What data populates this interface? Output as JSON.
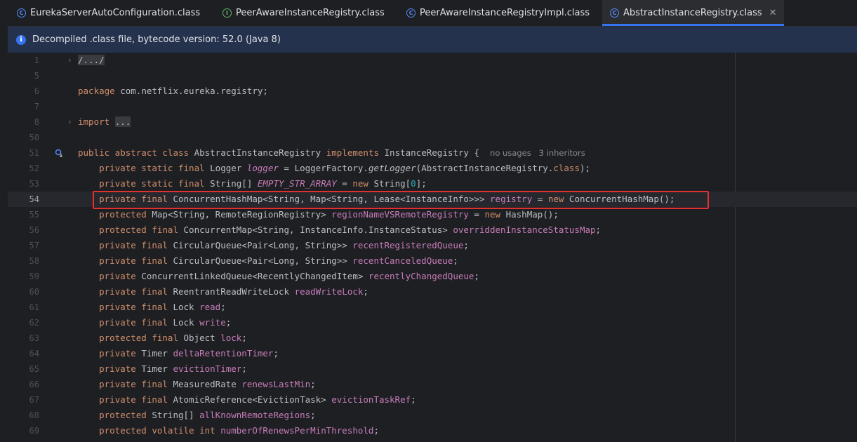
{
  "tabs": [
    {
      "label": "EurekaServerAutoConfiguration.class",
      "icon": "class-icon"
    },
    {
      "label": "PeerAwareInstanceRegistry.class",
      "icon": "interface-icon"
    },
    {
      "label": "PeerAwareInstanceRegistryImpl.class",
      "icon": "class-icon"
    },
    {
      "label": "AbstractInstanceRegistry.class",
      "icon": "class-icon"
    }
  ],
  "active_tab_close": "✕",
  "banner": {
    "text": "Decompiled .class file, bytecode version: 52.0 (Java 8)"
  },
  "editor": {
    "current_line": "54",
    "lines": [
      {
        "num": "1",
        "tokens": [
          {
            "t": "/.../",
            "c": "fc"
          }
        ]
      },
      {
        "num": "5",
        "tokens": []
      },
      {
        "num": "6",
        "tokens": [
          {
            "t": "package ",
            "c": "k"
          },
          {
            "t": "com.netflix.eureka.registry;"
          }
        ]
      },
      {
        "num": "7",
        "tokens": []
      },
      {
        "num": "8",
        "tokens": [
          {
            "t": "import ",
            "c": "k"
          },
          {
            "t": "...",
            "c": "fc"
          }
        ]
      },
      {
        "num": "50",
        "tokens": []
      },
      {
        "num": "51",
        "tokens": [
          {
            "t": "public abstract class ",
            "c": "k"
          },
          {
            "t": "AbstractInstanceRegistry "
          },
          {
            "t": "implements ",
            "c": "k"
          },
          {
            "t": "InstanceRegistry {  "
          },
          {
            "t": "no usages   3 inheritors",
            "c": "hint"
          }
        ]
      },
      {
        "num": "52",
        "tokens": [
          {
            "t": "    private static final ",
            "c": "k"
          },
          {
            "t": "Logger "
          },
          {
            "t": "logger",
            "c": "fi"
          },
          {
            "t": " = LoggerFactory."
          },
          {
            "t": "getLogger",
            "c": "m"
          },
          {
            "t": "(AbstractInstanceRegistry."
          },
          {
            "t": "class",
            "c": "k"
          },
          {
            "t": ");"
          }
        ]
      },
      {
        "num": "53",
        "tokens": [
          {
            "t": "    private static final ",
            "c": "k"
          },
          {
            "t": "String[] "
          },
          {
            "t": "EMPTY_STR_ARRAY",
            "c": "fi"
          },
          {
            "t": " = "
          },
          {
            "t": "new ",
            "c": "k"
          },
          {
            "t": "String["
          },
          {
            "t": "0",
            "c": "n"
          },
          {
            "t": "];"
          }
        ]
      },
      {
        "num": "54",
        "tokens": [
          {
            "t": "    private final ",
            "c": "k"
          },
          {
            "t": "ConcurrentHashMap<String, Map<String, Lease<InstanceInfo>>> "
          },
          {
            "t": "registry",
            "c": "f"
          },
          {
            "t": " = "
          },
          {
            "t": "new ",
            "c": "k"
          },
          {
            "t": "ConcurrentHashMap();"
          }
        ]
      },
      {
        "num": "55",
        "tokens": [
          {
            "t": "    protected ",
            "c": "k"
          },
          {
            "t": "Map<String, RemoteRegionRegistry> "
          },
          {
            "t": "regionNameVSRemoteRegistry",
            "c": "f"
          },
          {
            "t": " = "
          },
          {
            "t": "new ",
            "c": "k"
          },
          {
            "t": "HashMap();"
          }
        ]
      },
      {
        "num": "56",
        "tokens": [
          {
            "t": "    protected final ",
            "c": "k"
          },
          {
            "t": "ConcurrentMap<String, InstanceInfo.InstanceStatus> "
          },
          {
            "t": "overriddenInstanceStatusMap",
            "c": "f"
          },
          {
            "t": ";"
          }
        ]
      },
      {
        "num": "57",
        "tokens": [
          {
            "t": "    private final ",
            "c": "k"
          },
          {
            "t": "CircularQueue<Pair<Long, String>> "
          },
          {
            "t": "recentRegisteredQueue",
            "c": "f"
          },
          {
            "t": ";"
          }
        ]
      },
      {
        "num": "58",
        "tokens": [
          {
            "t": "    private final ",
            "c": "k"
          },
          {
            "t": "CircularQueue<Pair<Long, String>> "
          },
          {
            "t": "recentCanceledQueue",
            "c": "f"
          },
          {
            "t": ";"
          }
        ]
      },
      {
        "num": "59",
        "tokens": [
          {
            "t": "    private ",
            "c": "k"
          },
          {
            "t": "ConcurrentLinkedQueue<RecentlyChangedItem> "
          },
          {
            "t": "recentlyChangedQueue",
            "c": "f"
          },
          {
            "t": ";"
          }
        ]
      },
      {
        "num": "60",
        "tokens": [
          {
            "t": "    private final ",
            "c": "k"
          },
          {
            "t": "ReentrantReadWriteLock "
          },
          {
            "t": "readWriteLock",
            "c": "f"
          },
          {
            "t": ";"
          }
        ]
      },
      {
        "num": "61",
        "tokens": [
          {
            "t": "    private final ",
            "c": "k"
          },
          {
            "t": "Lock "
          },
          {
            "t": "read",
            "c": "f"
          },
          {
            "t": ";"
          }
        ]
      },
      {
        "num": "62",
        "tokens": [
          {
            "t": "    private final ",
            "c": "k"
          },
          {
            "t": "Lock "
          },
          {
            "t": "write",
            "c": "f"
          },
          {
            "t": ";"
          }
        ]
      },
      {
        "num": "63",
        "tokens": [
          {
            "t": "    protected final ",
            "c": "k"
          },
          {
            "t": "Object "
          },
          {
            "t": "lock",
            "c": "f"
          },
          {
            "t": ";"
          }
        ]
      },
      {
        "num": "64",
        "tokens": [
          {
            "t": "    private ",
            "c": "k"
          },
          {
            "t": "Timer "
          },
          {
            "t": "deltaRetentionTimer",
            "c": "f"
          },
          {
            "t": ";"
          }
        ]
      },
      {
        "num": "65",
        "tokens": [
          {
            "t": "    private ",
            "c": "k"
          },
          {
            "t": "Timer "
          },
          {
            "t": "evictionTimer",
            "c": "f"
          },
          {
            "t": ";"
          }
        ]
      },
      {
        "num": "66",
        "tokens": [
          {
            "t": "    private final ",
            "c": "k"
          },
          {
            "t": "MeasuredRate "
          },
          {
            "t": "renewsLastMin",
            "c": "f"
          },
          {
            "t": ";"
          }
        ]
      },
      {
        "num": "67",
        "tokens": [
          {
            "t": "    private final ",
            "c": "k"
          },
          {
            "t": "AtomicReference<EvictionTask> "
          },
          {
            "t": "evictionTaskRef",
            "c": "f"
          },
          {
            "t": ";"
          }
        ]
      },
      {
        "num": "68",
        "tokens": [
          {
            "t": "    protected ",
            "c": "k"
          },
          {
            "t": "String[] "
          },
          {
            "t": "allKnownRemoteRegions",
            "c": "f"
          },
          {
            "t": ";"
          }
        ]
      },
      {
        "num": "69",
        "tokens": [
          {
            "t": "    protected volatile int ",
            "c": "k"
          },
          {
            "t": "numberOfRenewsPerMinThreshold",
            "c": "f"
          },
          {
            "t": ";"
          }
        ]
      }
    ]
  }
}
